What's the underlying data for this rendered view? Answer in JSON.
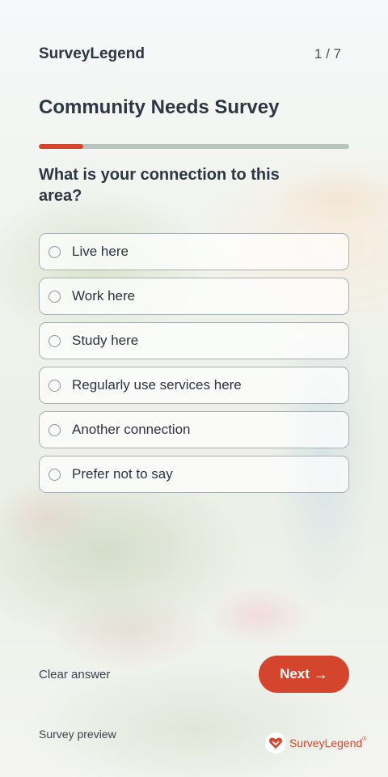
{
  "header": {
    "brand": "SurveyLegend",
    "counter": "1 / 7"
  },
  "survey": {
    "title": "Community Needs Survey",
    "progress_fraction": 0.143
  },
  "question": {
    "text": "What is your connection to this area?",
    "options": [
      "Live here",
      "Work here",
      "Study here",
      "Regularly use services here",
      "Another connection",
      "Prefer not to say"
    ]
  },
  "actions": {
    "clear_label": "Clear answer",
    "next_label": "Next",
    "next_arrow": "→"
  },
  "footer": {
    "preview_label": "Survey preview",
    "logo_text": "SurveyLegend",
    "logo_reg": "®"
  },
  "colors": {
    "accent": "#d3452c",
    "text": "#2d3643",
    "progress_track": "#b8c4bd"
  },
  "icons": {
    "logo": "surveylegend-heart-icon",
    "radio": "radio-unchecked-icon",
    "next": "arrow-right-icon"
  }
}
